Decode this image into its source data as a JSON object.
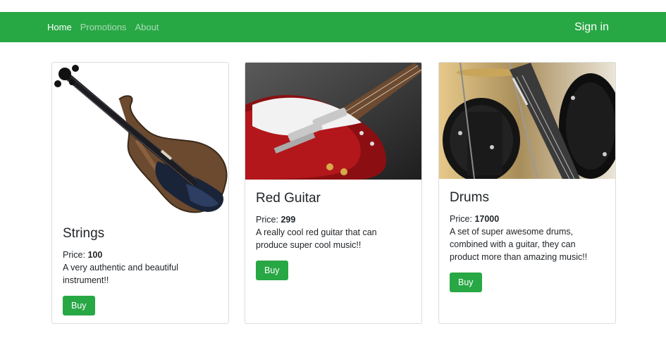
{
  "nav": {
    "links": [
      "Home",
      "Promotions",
      "About"
    ],
    "signin": "Sign in"
  },
  "products": [
    {
      "title": "Strings",
      "price_label": "Price:",
      "price": "100",
      "description": "A very authentic and beautiful instrument!!",
      "button": "Buy"
    },
    {
      "title": "Red Guitar",
      "price_label": "Price:",
      "price": "299",
      "description": "A really cool red guitar that can produce super cool music!!",
      "button": "Buy"
    },
    {
      "title": "Drums",
      "price_label": "Price:",
      "price": "17000",
      "description": "A set of super awesome drums, combined with a guitar, they can product more than amazing music!!",
      "button": "Buy"
    }
  ],
  "colors": {
    "brand": "#28a745"
  }
}
